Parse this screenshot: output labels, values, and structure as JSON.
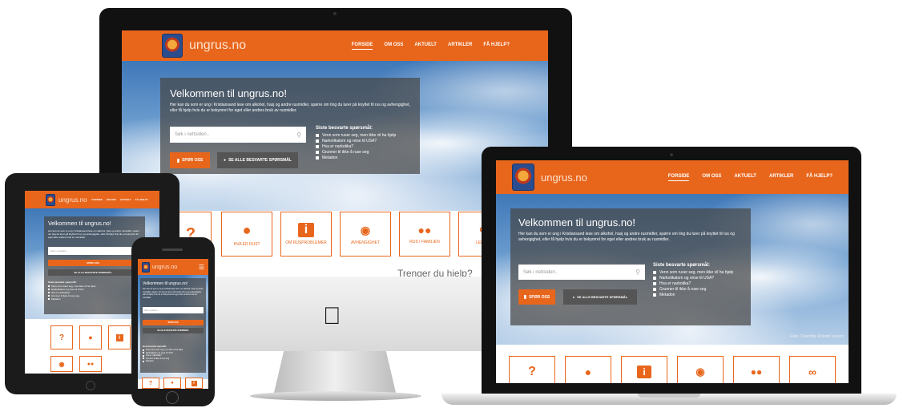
{
  "site": {
    "brand": "ungrus.no",
    "nav": [
      "FORSIDE",
      "OM OSS",
      "AKTUELT",
      "ARTIKLER",
      "FÅ HJELP?"
    ],
    "welcome_title": "Velkommen til ungrus.no!",
    "welcome_text": "Her kan du som er ung i Kristiansand lese om alkohol, hasj og andre rusmidler, spørre om ting du lurer på knyttet til rus og avhengighet, eller få hjelp hvis du er bekymret for eget eller andres bruk av rusmidler.",
    "search_placeholder": "Søk i nettsiden..",
    "ask_button": "SPØR OSS",
    "all_answers_button": "SE ALLE BESVARTE SPØRSMÅL",
    "questions_title": "Siste besvarte spørsmål:",
    "questions": [
      "Venn som ruser seg, men ikke vil ha hjelp",
      "Narkotikatom og reise til USA?",
      "Hva er narkotika?",
      "Grunner til ikke å ruse seg",
      "Metadon"
    ],
    "photo_credit": "Foto: Charlotte Roland Larsen",
    "tiles": [
      "",
      "HVA ER RUS?",
      "OM RUSPROBLEMER",
      "AVHENGIGHET",
      "RUS I FAMILIEN",
      "LENKER"
    ],
    "help_heading": "Trenger du hjelp?"
  },
  "icons": {
    "apple_logo": "apple-logo-icon",
    "question": "question-icon",
    "chat": "chat-icon",
    "info": "info-icon",
    "brain": "brain-icon",
    "family": "family-icon",
    "link": "link-icon",
    "search": "search-icon"
  },
  "colors": {
    "brand_orange": "#e8661c",
    "panel": "#464646",
    "device_black": "#111111"
  }
}
